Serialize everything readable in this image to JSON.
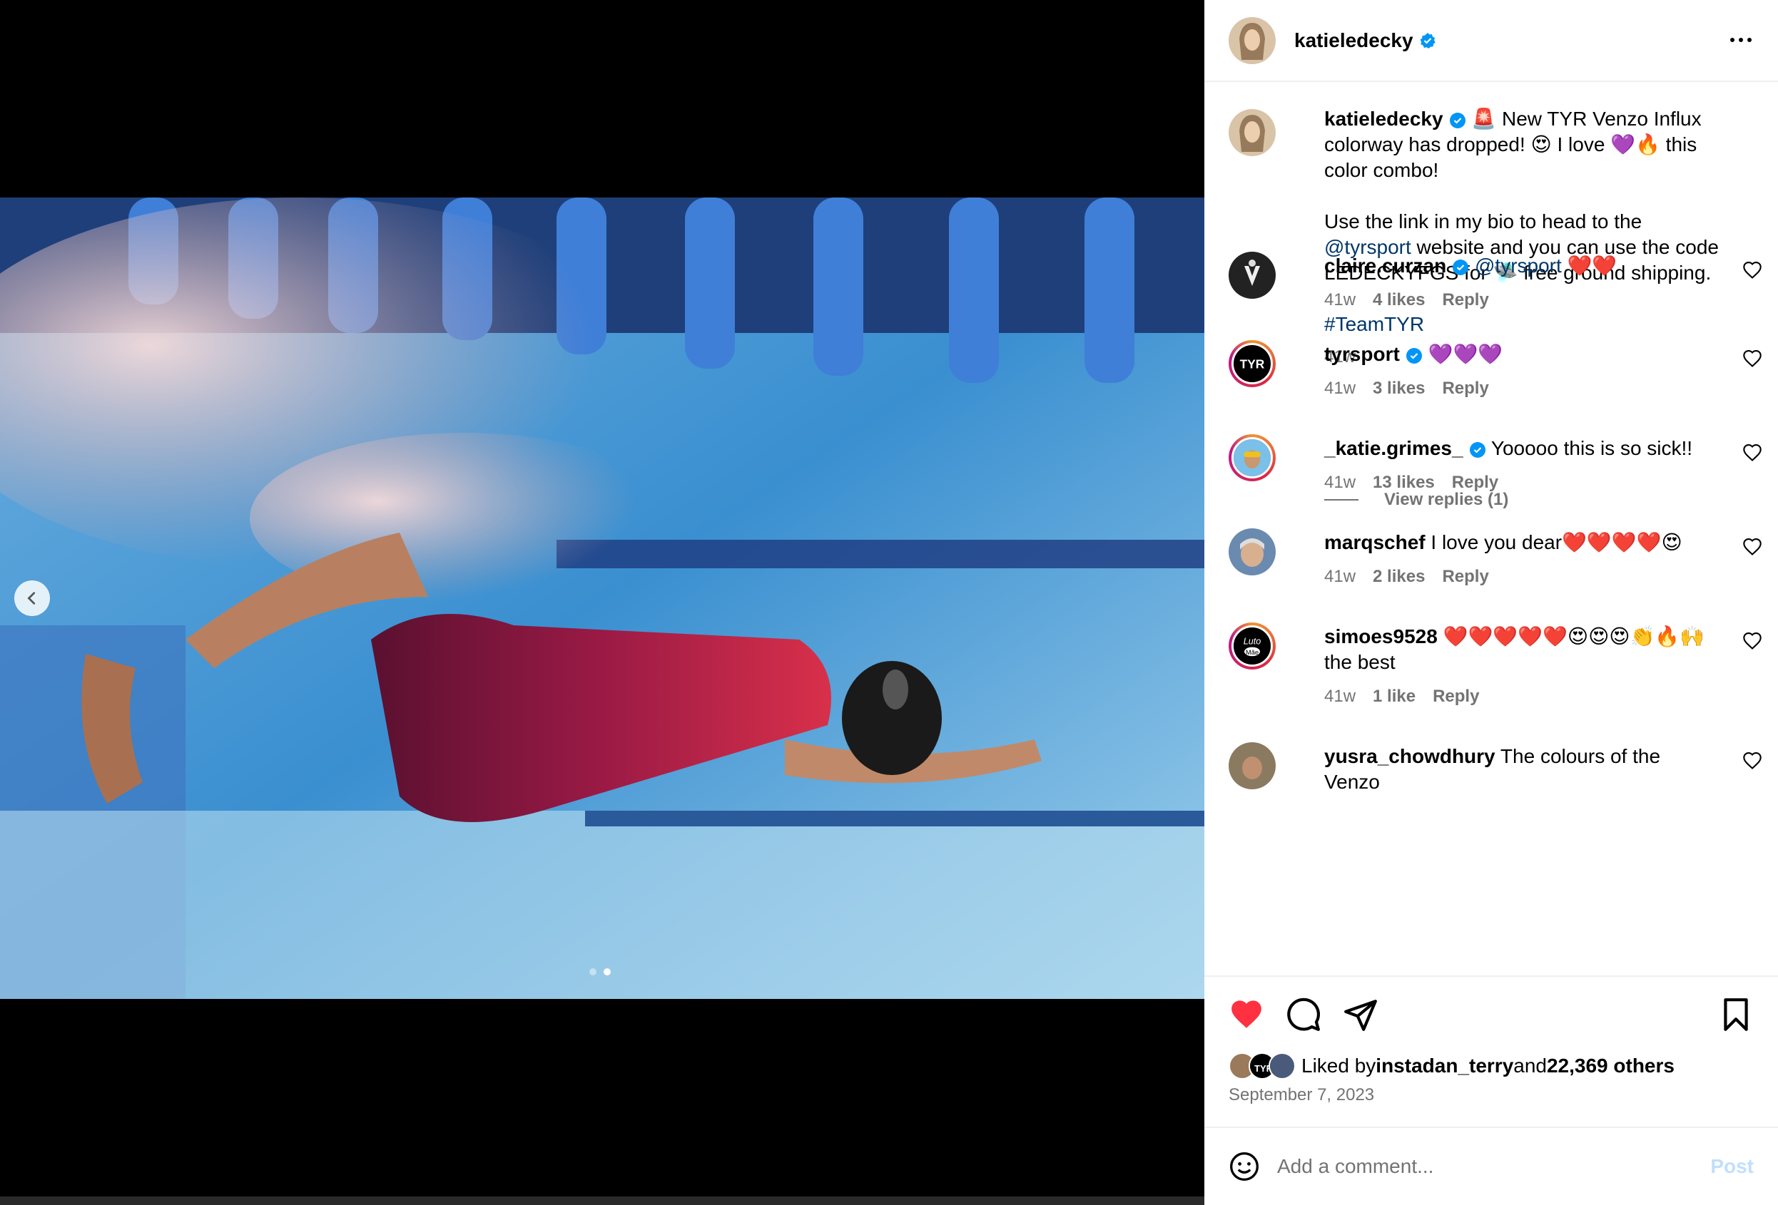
{
  "post": {
    "username": "katieledecky",
    "caption_line1": " New TYR Venzo Influx colorway has dropped! 😍 I love 💜🔥 this color combo!",
    "caption_line2_pre": "Use the link in my bio to head to the ",
    "caption_mention": "@tyrsport",
    "caption_line2_post": " website and you can use the code LEDECKYFGS for 🛸 free ground shipping.",
    "caption_hashtag": "#TeamTYR",
    "caption_time": "41w",
    "siren": "🚨"
  },
  "comments": [
    {
      "username": "claire.curzan",
      "verified": true,
      "mention": "@tyrsport",
      "text": " ❤️❤️",
      "time": "41w",
      "likes": "4 likes",
      "reply": "Reply"
    },
    {
      "username": "tyrsport",
      "verified": true,
      "text": " 💜💜💜",
      "time": "41w",
      "likes": "3 likes",
      "reply": "Reply"
    },
    {
      "username": "_katie.grimes_",
      "verified": true,
      "text": " Yooooo this is so sick!!",
      "time": "41w",
      "likes": "13 likes",
      "reply": "Reply"
    },
    {
      "username": "marqschef",
      "verified": false,
      "text": " I love you dear❤️❤️❤️❤️😍",
      "time": "41w",
      "likes": "2 likes",
      "reply": "Reply"
    },
    {
      "username": "simoes9528",
      "verified": false,
      "text": " ❤️❤️❤️❤️❤️😍😍😍👏🔥🙌the best",
      "time": "41w",
      "likes": "1 like",
      "reply": "Reply"
    },
    {
      "username": "yusra_chowdhury",
      "verified": false,
      "text": " The colours of the Venzo"
    }
  ],
  "view_replies": "View replies (1)",
  "likes": {
    "prefix": "Liked by ",
    "user": "instadan_terry",
    "middle": " and ",
    "count": "22,369 others"
  },
  "date": "September 7, 2023",
  "comment_box": {
    "placeholder": "Add a comment...",
    "post_label": "Post"
  },
  "avatar_text": {
    "tyr": "TYR",
    "luto": "Luto",
    "mae": "Mãe"
  },
  "colors": {
    "accent": "#0095f6",
    "like_red": "#ff3040",
    "link": "#00376b",
    "verified": "#0095f6",
    "muted": "#737373"
  },
  "icons": [
    "chevron-left-icon",
    "more-icon",
    "verified-icon",
    "heart-icon",
    "comment-icon",
    "share-icon",
    "bookmark-icon",
    "emoji-icon"
  ],
  "carousel": {
    "current": 2,
    "total": 2
  }
}
